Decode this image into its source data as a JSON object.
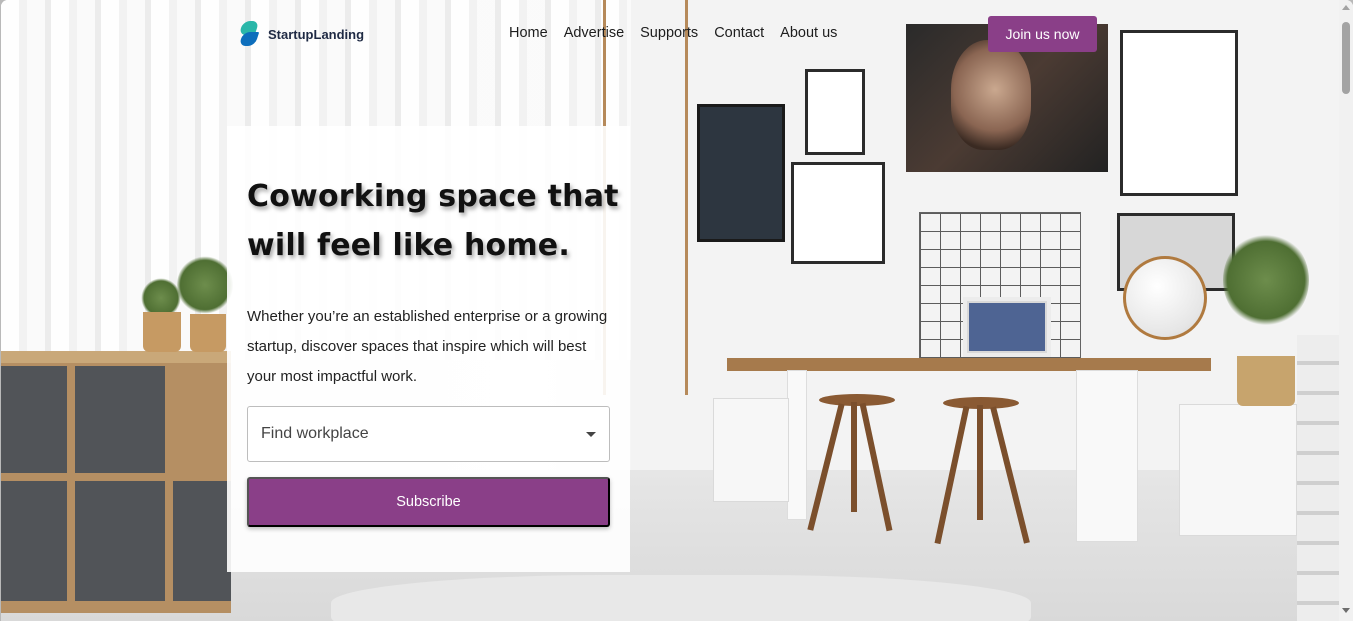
{
  "brand": {
    "name": "StartupLanding",
    "icon": "startup-logo-icon"
  },
  "nav": {
    "links": [
      "Home",
      "Advertise",
      "Supports",
      "Contact",
      "About us"
    ],
    "cta": "Join us now"
  },
  "hero": {
    "headline": "Coworking space that will feel like home.",
    "lead": "Whether you’re an established enterprise or a growing startup, discover spaces that inspire which will best your most impactful work.",
    "select": {
      "value": "Find workplace",
      "icon": "caret-down-icon"
    },
    "button": "Subscribe"
  },
  "colors": {
    "accent": "#8a3f88",
    "logo_teal": "#2ab7a9",
    "logo_blue": "#0d6ebc",
    "text_dark": "#111111"
  },
  "background": {
    "description_icon": "coworking-photo"
  }
}
